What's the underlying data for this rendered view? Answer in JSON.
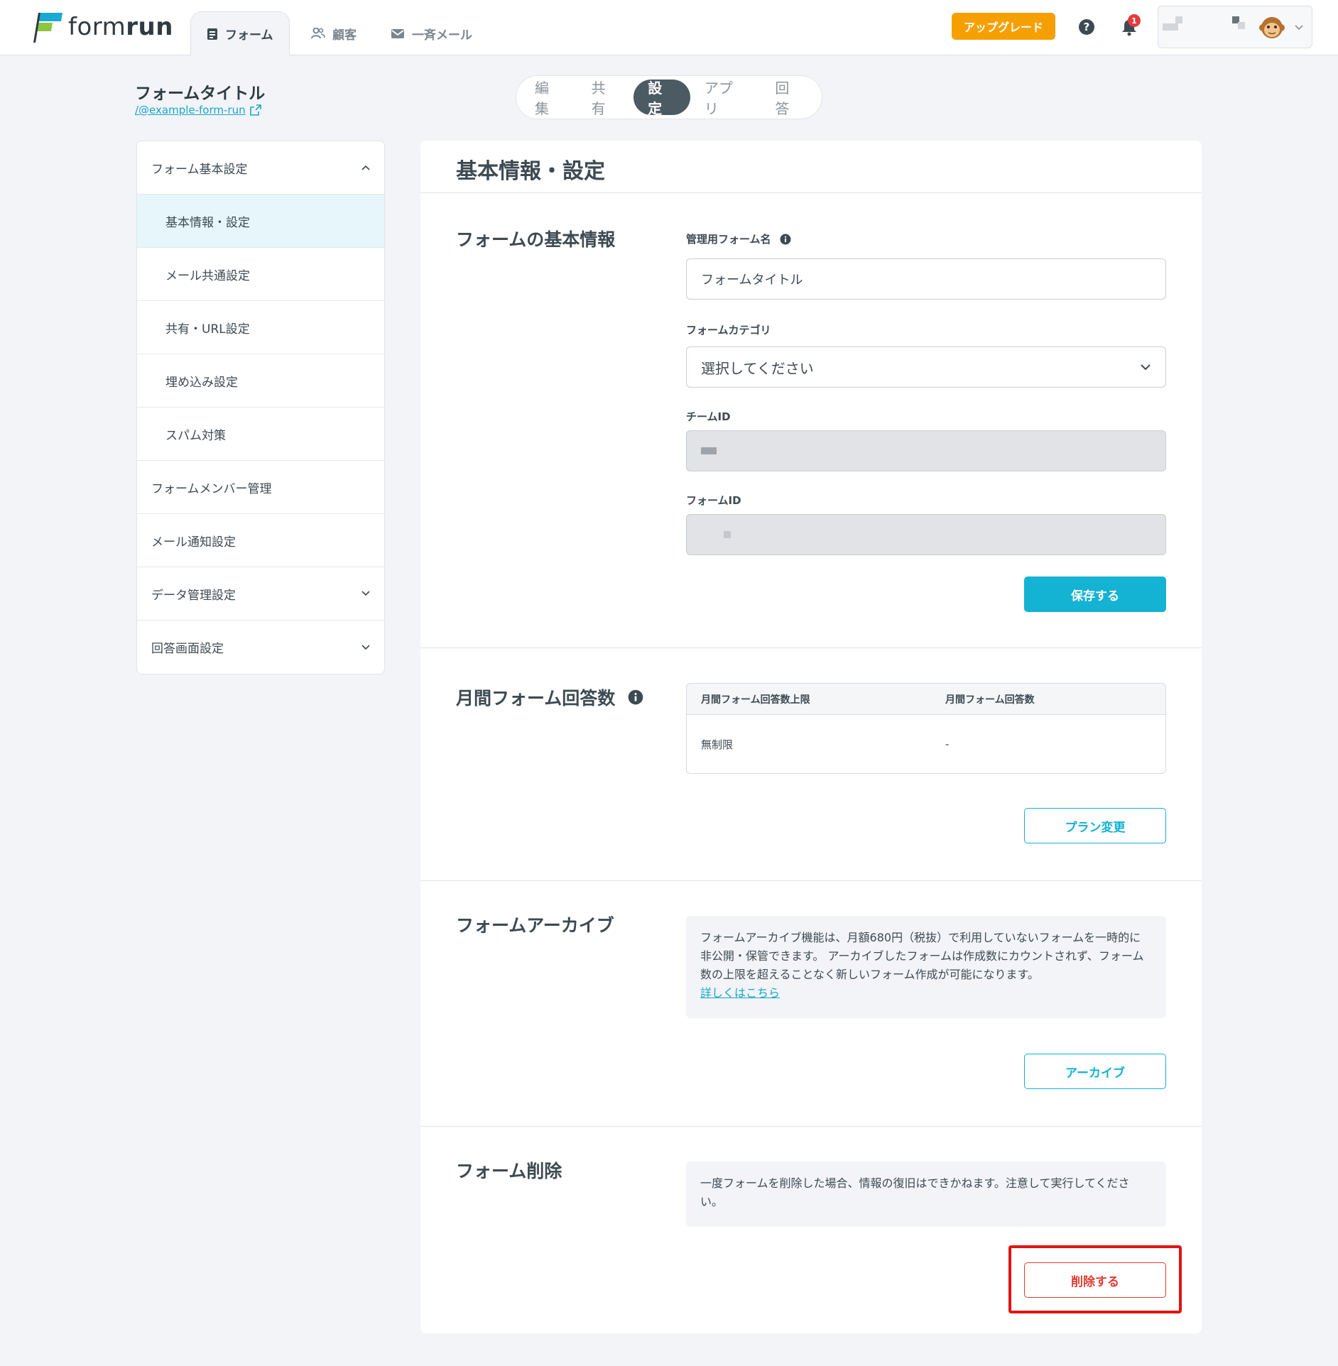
{
  "header": {
    "logo_text_light": "form",
    "logo_text_bold": "run",
    "tabs": [
      {
        "label": "フォーム",
        "icon": "document-icon"
      },
      {
        "label": "顧客",
        "icon": "users-icon"
      },
      {
        "label": "一斉メール",
        "icon": "mail-icon"
      }
    ],
    "upgrade_label": "アップグレード",
    "notification_count": "1"
  },
  "form": {
    "title": "フォームタイトル",
    "slug": "/@example-form-run"
  },
  "mode_tabs": [
    "編集",
    "共有",
    "設定",
    "アプリ",
    "回答"
  ],
  "sidebar": {
    "items": [
      {
        "label": "フォーム基本設定"
      },
      {
        "label": "基本情報・設定"
      },
      {
        "label": "メール共通設定"
      },
      {
        "label": "共有・URL設定"
      },
      {
        "label": "埋め込み設定"
      },
      {
        "label": "スパム対策"
      },
      {
        "label": "フォームメンバー管理"
      },
      {
        "label": "メール通知設定"
      },
      {
        "label": "データ管理設定"
      },
      {
        "label": "回答画面設定"
      }
    ]
  },
  "main": {
    "title": "基本情報・設定",
    "basic": {
      "title": "フォームの基本情報",
      "admin_name_label": "管理用フォーム名",
      "admin_name_value": "フォームタイトル",
      "category_label": "フォームカテゴリ",
      "category_value": "選択してください",
      "team_id_label": "チームID",
      "form_id_label": "フォームID",
      "save_label": "保存する"
    },
    "quota": {
      "title": "月間フォーム回答数",
      "col1": "月間フォーム回答数上限",
      "col2": "月間フォーム回答数",
      "val1": "無制限",
      "val2": "-",
      "plan_label": "プラン変更"
    },
    "archive": {
      "title": "フォームアーカイブ",
      "text": "フォームアーカイブ機能は、月額680円（税抜）で利用していないフォームを一時的に非公開・保管できます。 アーカイブしたフォームは作成数にカウントされず、フォーム数の上限を超えることなく新しいフォーム作成が可能になります。",
      "link": "詳しくはこちら",
      "button_label": "アーカイブ"
    },
    "delete": {
      "title": "フォーム削除",
      "text": "一度フォームを削除した場合、情報の復旧はできかねます。注意して実行してください。",
      "button_label": "削除する"
    }
  },
  "colors": {
    "accent": "#14b2d3",
    "upgrade": "#f5a000",
    "danger": "#e03c2f",
    "highlight": "#e01414"
  }
}
